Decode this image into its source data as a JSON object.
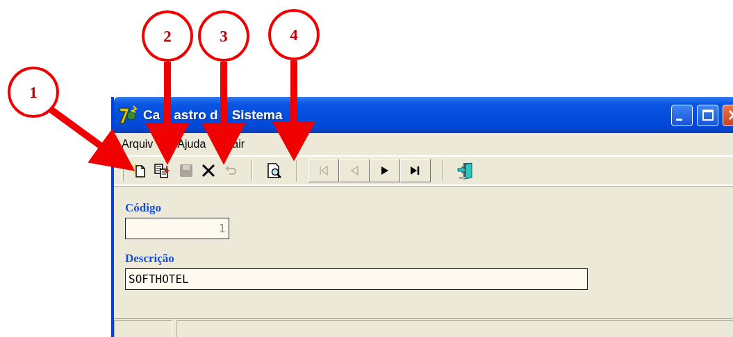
{
  "window": {
    "title_visible_parts": [
      "Ca",
      "astro d",
      "Sistema"
    ]
  },
  "menu": [
    {
      "label": "Arquiv"
    },
    {
      "label": "Ajuda"
    },
    {
      "label": "air"
    }
  ],
  "toolbar": [
    {
      "kind": "new",
      "disabled": false
    },
    {
      "kind": "copy",
      "disabled": false
    },
    {
      "kind": "save",
      "disabled": true
    },
    {
      "kind": "delete",
      "disabled": false
    },
    {
      "kind": "undo",
      "disabled": true
    },
    {
      "kind": "separator"
    },
    {
      "kind": "preview",
      "disabled": false
    },
    {
      "kind": "separator"
    },
    {
      "kind": "first",
      "disabled": true
    },
    {
      "kind": "prev",
      "disabled": true
    },
    {
      "kind": "next",
      "disabled": false
    },
    {
      "kind": "last",
      "disabled": false
    },
    {
      "kind": "separator"
    },
    {
      "kind": "exit",
      "disabled": false
    }
  ],
  "fields": [
    {
      "label": "Código",
      "value": "1",
      "disabled": true
    },
    {
      "label": "Descrição",
      "value": "SOFTHOTEL",
      "disabled": false
    }
  ],
  "callouts": [
    {
      "number": "1"
    },
    {
      "number": "2"
    },
    {
      "number": "3"
    },
    {
      "number": "4"
    }
  ]
}
